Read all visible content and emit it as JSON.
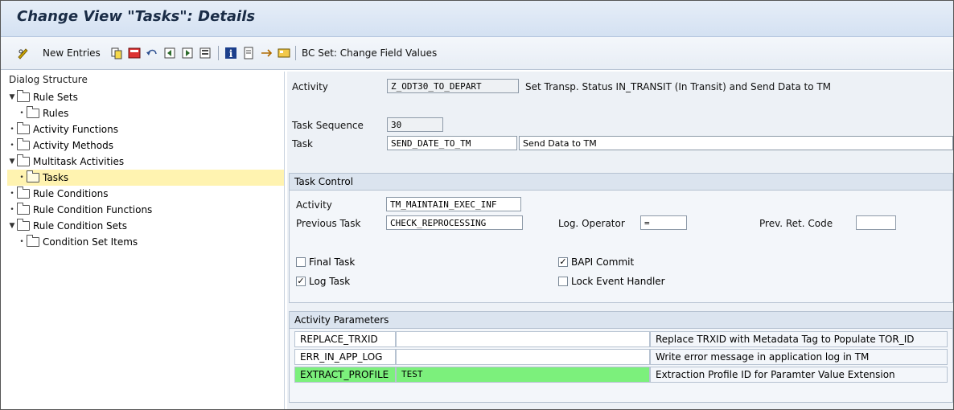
{
  "title": "Change View \"Tasks\": Details",
  "toolbar": {
    "new_entries": "New Entries",
    "bc_set": "BC Set: Change Field Values"
  },
  "dialog": {
    "header": "Dialog Structure",
    "items": [
      {
        "label": "Rule Sets"
      },
      {
        "label": "Rules"
      },
      {
        "label": "Activity Functions"
      },
      {
        "label": "Activity Methods"
      },
      {
        "label": "Multitask Activities"
      },
      {
        "label": "Tasks"
      },
      {
        "label": "Rule Conditions"
      },
      {
        "label": "Rule Condition Functions"
      },
      {
        "label": "Rule Condition Sets"
      },
      {
        "label": "Condition Set Items"
      }
    ]
  },
  "header_fields": {
    "activity_label": "Activity",
    "activity_value": "Z_ODT30_TO_DEPART",
    "activity_desc": "Set Transp. Status IN_TRANSIT (In Transit) and Send Data to TM",
    "task_seq_label": "Task Sequence",
    "task_seq_value": "30",
    "task_label": "Task",
    "task_value": "SEND_DATE_TO_TM",
    "task_desc": "Send Data to TM"
  },
  "task_control": {
    "title": "Task Control",
    "activity_label": "Activity",
    "activity_value": "TM_MAINTAIN_EXEC_INF",
    "prev_task_label": "Previous Task",
    "prev_task_value": "CHECK_REPROCESSING",
    "log_op_label": "Log. Operator",
    "log_op_value": "=",
    "prev_ret_label": "Prev. Ret. Code",
    "prev_ret_value": "",
    "final_task": "Final Task",
    "bapi_commit": "BAPI Commit",
    "log_task": "Log Task",
    "lock_eh": "Lock Event Handler"
  },
  "params": {
    "title": "Activity Parameters",
    "rows": [
      {
        "name": "REPLACE_TRXID",
        "value": "",
        "desc": "Replace TRXID with Metadata Tag to Populate TOR_ID"
      },
      {
        "name": "ERR_IN_APP_LOG",
        "value": "",
        "desc": "Write error message in application log in TM"
      },
      {
        "name": "EXTRACT_PROFILE",
        "value": "TEST",
        "desc": "Extraction Profile ID for Paramter Value Extension"
      }
    ]
  }
}
